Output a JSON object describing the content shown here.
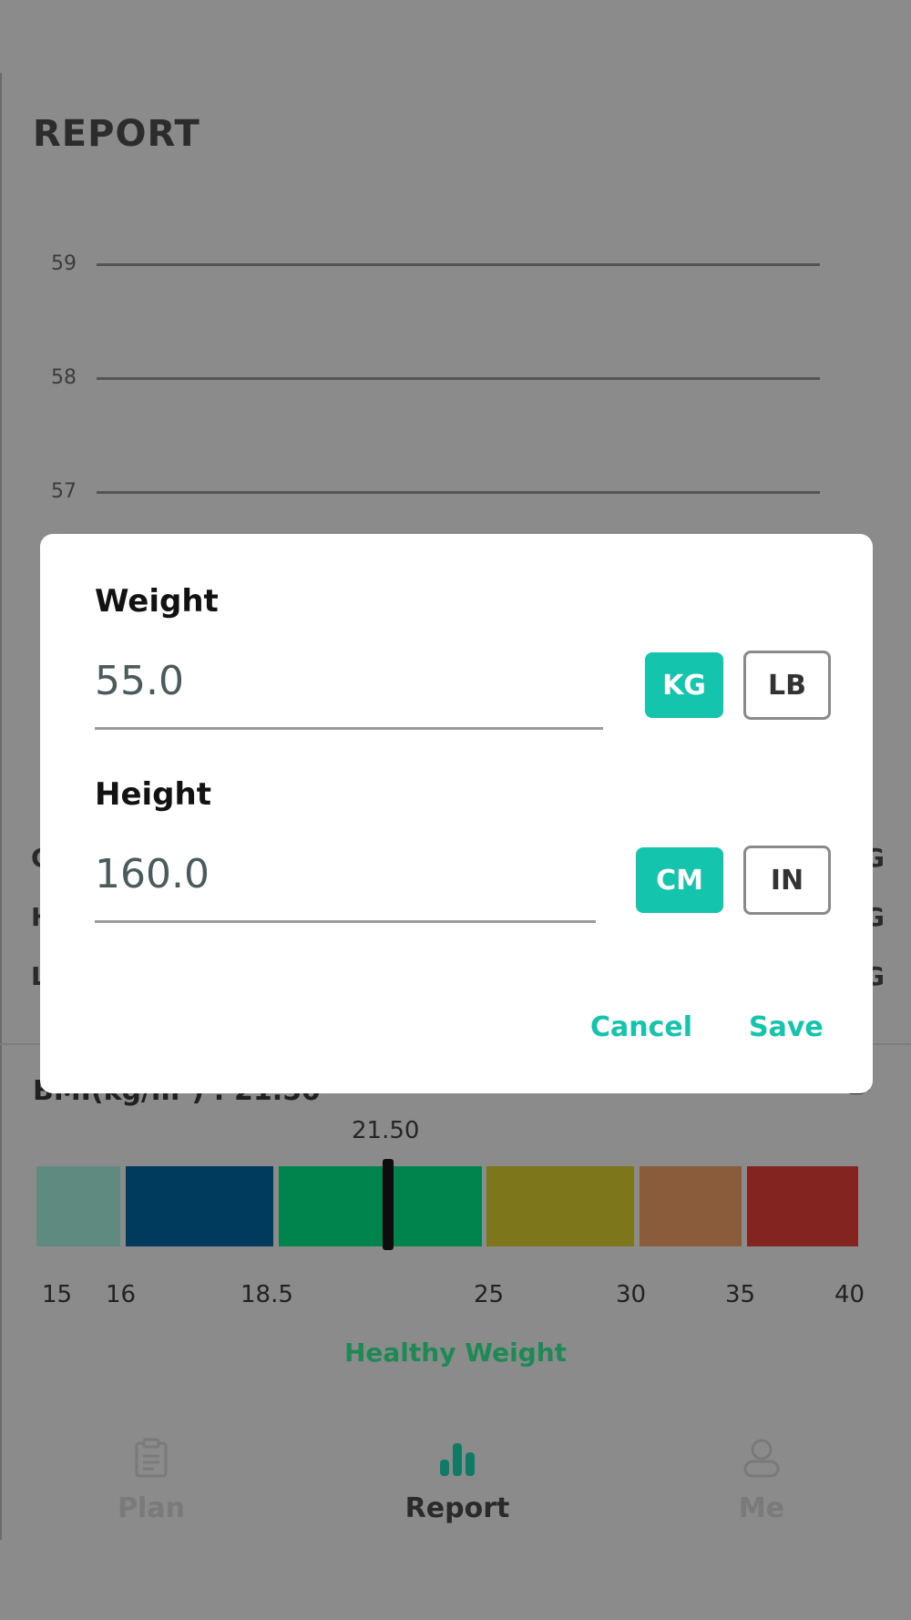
{
  "screen": {
    "title": "REPORT"
  },
  "chart": {
    "gridlines": [
      "59",
      "58",
      "57"
    ]
  },
  "peek": {
    "left_letters": [
      "C",
      "H",
      "L"
    ],
    "right_letters": [
      "G",
      "G",
      "G"
    ]
  },
  "bmi": {
    "title": "BMI(kg/m²) :  21.50",
    "edit_char": "✏",
    "value": 21.5,
    "value_label": "21.50",
    "ticks": [
      "15",
      "16",
      "18.5",
      "25",
      "30",
      "35",
      "40"
    ],
    "status": "Healthy Weight",
    "segment_colors": [
      "#5f8a80",
      "#003a5c",
      "#00844e",
      "#00844e",
      "#7d761a",
      "#8b5c3c",
      "#832420"
    ]
  },
  "nav": {
    "plan": "Plan",
    "report": "Report",
    "me": "Me"
  },
  "dialog": {
    "weight_label": "Weight",
    "weight_value": "55.0",
    "weight_units": [
      "KG",
      "LB"
    ],
    "weight_selected_unit": "KG",
    "height_label": "Height",
    "height_value": "160.0",
    "height_units": [
      "CM",
      "IN"
    ],
    "height_selected_unit": "CM",
    "cancel": "Cancel",
    "save": "Save"
  },
  "colors": {
    "accent": "#14c4ac",
    "scrim": "#8b8b8b",
    "healthy_text": "#1d8a56"
  }
}
